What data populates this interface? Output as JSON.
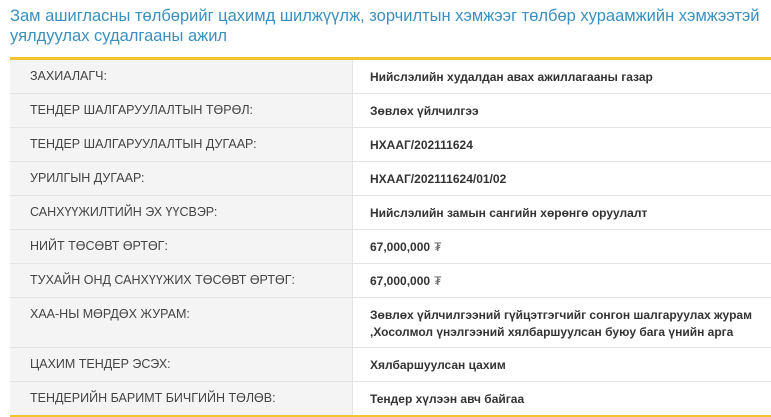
{
  "title": "Зам ашигласны төлбөрийг цахимд шилжүүлж, зорчилтын хэмжээг төлбөр хураамжийн хэмжээтэй уялдуулах судалгааны ажил",
  "rows": [
    {
      "label": "ЗАХИАЛАГЧ:",
      "value": "Нийслэлийн худалдан авах ажиллагааны газар"
    },
    {
      "label": "ТЕНДЕР ШАЛГАРУУЛАЛТЫН ТӨРӨЛ:",
      "value": "Зөвлөх үйлчилгээ"
    },
    {
      "label": "ТЕНДЕР ШАЛГАРУУЛАЛТЫН ДУГААР:",
      "value": "НХААГ/202111624"
    },
    {
      "label": "УРИЛГЫН ДУГААР:",
      "value": "НХААГ/202111624/01/02"
    },
    {
      "label": "САНХҮҮЖИЛТИЙН ЭХ ҮҮСВЭР:",
      "value": "Нийслэлийн замын сангийн хөрөнгө оруулалт"
    },
    {
      "label": "НИЙТ ТӨСӨВТ ӨРТӨГ:",
      "value": "67,000,000",
      "currency": "₮"
    },
    {
      "label": "ТУХАЙН ОНД САНХҮҮЖИХ ТӨСӨВТ ӨРТӨГ:",
      "value": "67,000,000",
      "currency": "₮"
    },
    {
      "label": "ХАА-НЫ МӨРДӨХ ЖУРАМ:",
      "value": "Зөвлөх үйлчилгээний гүйцэтгэгчийг сонгон шалгаруулах журам ,Хосолмол үнэлгээний хялбаршуулсан буюу бага үнийн арга"
    },
    {
      "label": "ЦАХИМ ТЕНДЕР ЭСЭХ:",
      "value": "Хялбаршуулсан цахим"
    },
    {
      "label": "ТЕНДЕРИЙН БАРИМТ БИЧГИЙН ТӨЛӨВ:",
      "value": "Тендер хүлээн авч байгаа"
    }
  ]
}
